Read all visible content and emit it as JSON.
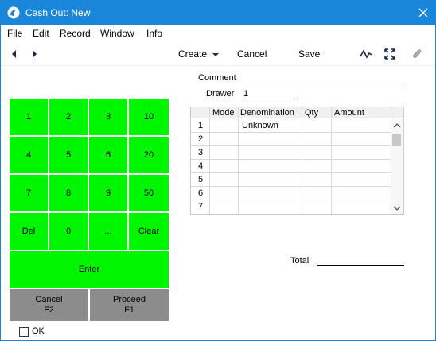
{
  "window": {
    "title": "Cash Out: New",
    "app_icon": "hansaworld-icon",
    "close_icon": "close-icon"
  },
  "menu": [
    "File",
    "Edit",
    "Record",
    "Window",
    "Info"
  ],
  "toolbar": {
    "back_icon": "back-arrow-icon",
    "forward_icon": "forward-arrow-icon",
    "create_label": "Create",
    "cancel_label": "Cancel",
    "save_label": "Save",
    "activity_icon": "pulse-icon",
    "expand_icon": "expand-icon",
    "attach_icon": "paperclip-icon"
  },
  "keypad": {
    "row1": [
      "1",
      "2",
      "3",
      "10"
    ],
    "row2": [
      "4",
      "5",
      "6",
      "20"
    ],
    "row3": [
      "7",
      "8",
      "9",
      "50"
    ],
    "row4": [
      "Del",
      "0",
      "...",
      "Clear"
    ],
    "enter": "Enter",
    "cancel": {
      "line1": "Cancel",
      "line2": "F2"
    },
    "proceed": {
      "line1": "Proceed",
      "line2": "F1"
    }
  },
  "form": {
    "comment_label": "Comment",
    "comment_value": "",
    "drawer_label": "Drawer",
    "drawer_value": "1",
    "total_label": "Total",
    "total_value": ""
  },
  "grid": {
    "columns": [
      "Mode",
      "Denomination",
      "Qty",
      "Amount"
    ],
    "rows": [
      {
        "n": "1",
        "mode": "",
        "denomination": "Unknown",
        "qty": "",
        "amount": ""
      },
      {
        "n": "2",
        "mode": "",
        "denomination": "",
        "qty": "",
        "amount": ""
      },
      {
        "n": "3",
        "mode": "",
        "denomination": "",
        "qty": "",
        "amount": ""
      },
      {
        "n": "4",
        "mode": "",
        "denomination": "",
        "qty": "",
        "amount": ""
      },
      {
        "n": "5",
        "mode": "",
        "denomination": "",
        "qty": "",
        "amount": ""
      },
      {
        "n": "6",
        "mode": "",
        "denomination": "",
        "qty": "",
        "amount": ""
      },
      {
        "n": "7",
        "mode": "",
        "denomination": "",
        "qty": "",
        "amount": ""
      }
    ]
  },
  "ok_label": "OK",
  "colors": {
    "titlebar": "#1a86d9",
    "key_green": "#00f500",
    "key_grey": "#8c8c8c"
  }
}
